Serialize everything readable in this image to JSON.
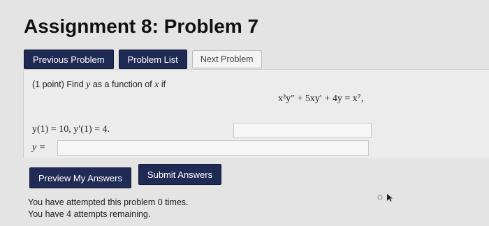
{
  "header": {
    "title": "Assignment 8: Problem 7"
  },
  "nav": {
    "previous_label": "Previous Problem",
    "list_label": "Problem List",
    "next_label": "Next Problem"
  },
  "problem": {
    "points": "(1 point)",
    "prompt_text": "Find",
    "var_y": "y",
    "as_function": "as a function of",
    "var_x": "x",
    "if_text": "if",
    "equation_text": "x²y″ + 5xy′ + 4y = x⁷,",
    "conditions": "y(1) = 10,  y′(1) = 4.",
    "answer_label": "y =",
    "answer_value": ""
  },
  "actions": {
    "preview_label": "Preview My Answers",
    "submit_label": "Submit Answers"
  },
  "status": {
    "attempted": "You have attempted this problem 0 times.",
    "remaining": "You have 4 attempts remaining."
  }
}
